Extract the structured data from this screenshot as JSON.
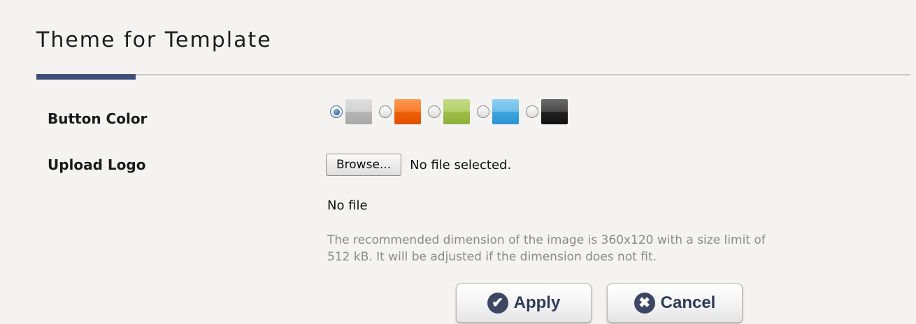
{
  "page": {
    "title": "Theme for Template"
  },
  "button_color": {
    "label": "Button Color",
    "options": [
      {
        "name": "gray",
        "color": "#b8b8b8",
        "selected": true
      },
      {
        "name": "orange",
        "color": "#f0680f",
        "selected": false
      },
      {
        "name": "green",
        "color": "#a2c452",
        "selected": false
      },
      {
        "name": "blue",
        "color": "#45a8e0",
        "selected": false
      },
      {
        "name": "black",
        "color": "#2a2a2a",
        "selected": false
      }
    ]
  },
  "upload_logo": {
    "label": "Upload Logo",
    "browse_label": "Browse...",
    "file_status": "No file selected.",
    "current_file": "No file",
    "hint": "The recommended dimension of the image is 360x120 with a size limit of 512 kB. It will be adjusted if the dimension does not fit."
  },
  "actions": {
    "apply_label": "Apply",
    "apply_icon": "checkmark-icon",
    "cancel_label": "Cancel",
    "cancel_icon": "close-icon"
  },
  "colors": {
    "accent": "#3d4f7a",
    "button_text": "#2d3b5c"
  }
}
